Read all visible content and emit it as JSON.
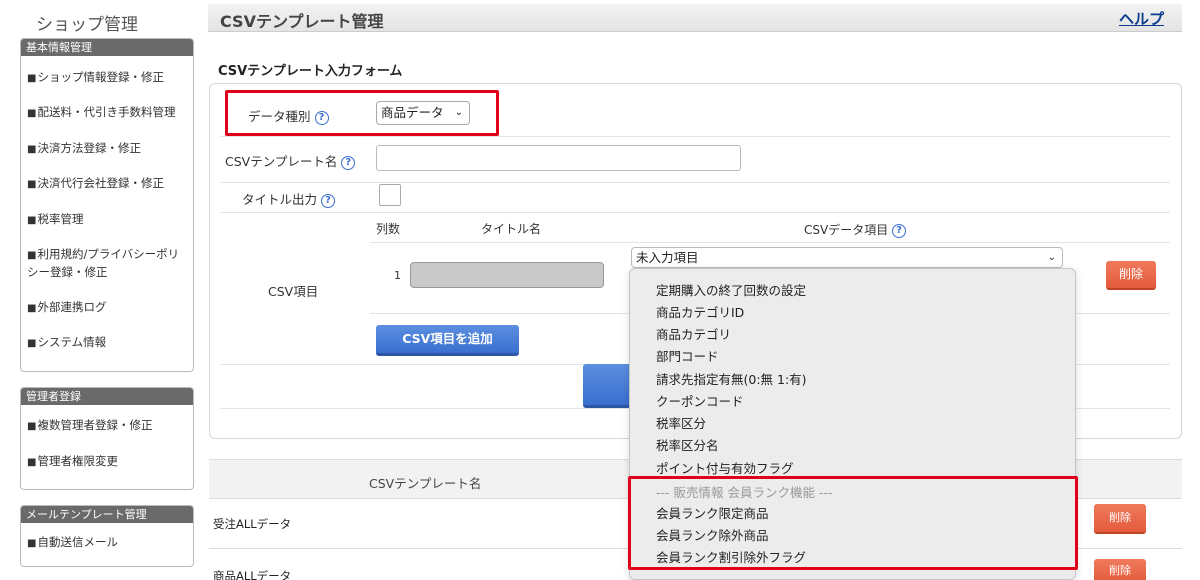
{
  "sidebar": {
    "title": "ショップ管理",
    "sections": [
      {
        "heading": "基本情報管理",
        "items": [
          "ショップ情報登録・修正",
          "配送料・代引き手数料管理",
          "決済方法登録・修正",
          "決済代行会社登録・修正",
          "税率管理",
          "利用規約/プライバシーポリ",
          "シー登録・修正",
          "外部連携ログ",
          "システム情報"
        ]
      },
      {
        "heading": "管理者登録",
        "items": [
          "複数管理者登録・修正",
          "管理者権限変更"
        ]
      },
      {
        "heading": "メールテンプレート管理",
        "items": [
          "自動送信メール"
        ]
      }
    ]
  },
  "header": {
    "title": "CSVテンプレート管理",
    "help": "ヘルプ"
  },
  "form": {
    "title": "CSVテンプレート入力フォーム",
    "data_type_label": "データ種別",
    "data_type_value": "商品データ",
    "template_name_label": "CSVテンプレート名",
    "title_output_label": "タイトル出力",
    "csv_item_label": "CSV項目",
    "col_count_header": "列数",
    "title_name_header": "タイトル名",
    "csv_data_item_header": "CSVデータ項目",
    "row_number": "1",
    "csv_data_item_value": "未入力項目",
    "delete_label": "削除",
    "add_button": "CSV項目を追加"
  },
  "dropdown": {
    "items": [
      "定期購入の終了回数の設定",
      "商品カテゴリID",
      "商品カテゴリ",
      "部門コード",
      "請求先指定有無(0:無 1:有)",
      "クーポンコード",
      "税率区分",
      "税率区分名",
      "ポイント付与有効フラグ"
    ],
    "group_label": "--- 販売情報 会員ランク機能 ---",
    "group_items": [
      "会員ランク限定商品",
      "会員ランク除外商品",
      "会員ランク割引除外フラグ"
    ]
  },
  "list": {
    "header": "CSVテンプレート名",
    "rows": [
      {
        "name": "受注ALLデータ",
        "delete": "削除"
      },
      {
        "name": "商品ALLデータ",
        "delete": "削除"
      }
    ]
  },
  "colors": {
    "accent_blue": "#3a6fcf",
    "delete_red": "#e35b3c",
    "highlight_red": "#e0001a"
  }
}
